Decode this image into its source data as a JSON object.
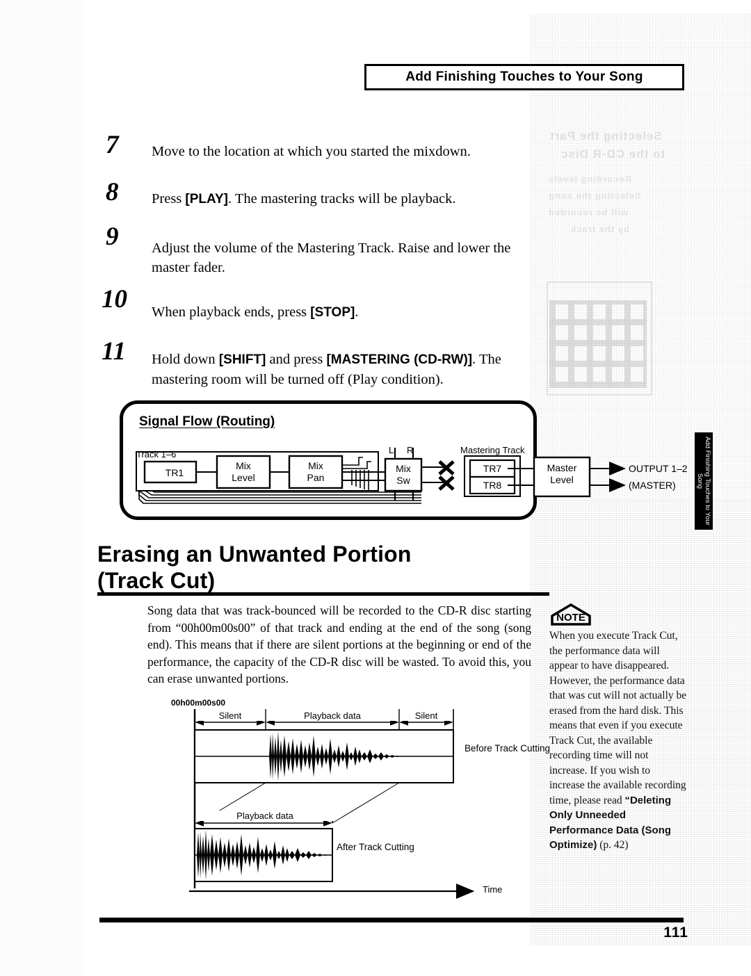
{
  "header": {
    "banner_title": "Add Finishing Touches to Your Song"
  },
  "side_tab": {
    "label": "Add Finishing Touches to Your Song"
  },
  "steps": [
    {
      "number": "7",
      "segments": [
        {
          "t": "Move to the location at which you started the mixdown.",
          "b": false
        }
      ]
    },
    {
      "number": "8",
      "segments": [
        {
          "t": "Press ",
          "b": false
        },
        {
          "t": "[PLAY]",
          "b": true
        },
        {
          "t": ". The mastering tracks will be playback.",
          "b": false
        }
      ]
    },
    {
      "number": "9",
      "segments": [
        {
          "t": "Adjust the volume of the Mastering Track. Raise and lower the master fader.",
          "b": false
        }
      ]
    },
    {
      "number": "10",
      "segments": [
        {
          "t": "When playback ends, press ",
          "b": false
        },
        {
          "t": "[STOP]",
          "b": true
        },
        {
          "t": ".",
          "b": false
        }
      ]
    },
    {
      "number": "11",
      "segments": [
        {
          "t": "Hold down ",
          "b": false
        },
        {
          "t": "[SHIFT]",
          "b": true
        },
        {
          "t": " and press ",
          "b": false
        },
        {
          "t": "[MASTERING (CD-RW)]",
          "b": true
        },
        {
          "t": ". The mastering room will be turned off (Play condition).",
          "b": false
        }
      ]
    }
  ],
  "signal_flow": {
    "title": "Signal Flow (Routing)",
    "labels": {
      "track_group": "Track 1–6",
      "tr1": "TR1",
      "mix_level": [
        "Mix",
        "Level"
      ],
      "mix_pan": [
        "Mix",
        "Pan"
      ],
      "l": "L",
      "r": "R",
      "mix_sw": [
        "Mix",
        "Sw"
      ],
      "mastering_track": "Mastering Track",
      "tr7": "TR7",
      "tr8": "TR8",
      "master_level": [
        "Master",
        "Level"
      ],
      "output_line1": "OUTPUT 1–2",
      "output_line2": "(MASTER)"
    }
  },
  "section": {
    "heading_line1": "Erasing an Unwanted Portion",
    "heading_line2": "(Track Cut)",
    "body": "Song data that was track-bounced will be recorded to the CD-R disc starting from “00h00m00s00” of that track and ending at the end of the song (song end). This means that if there are silent portions at the beginning or end of the performance, the capacity of the CD-R disc will be wasted. To avoid this, you can erase unwanted portions."
  },
  "figure": {
    "timecode": "00h00m00s00",
    "silent_left": "Silent",
    "playback_data": "Playback data",
    "silent_right": "Silent",
    "before_label": "Before Track Cutting",
    "playback_data_after": "Playback data",
    "after_label": "After Track Cutting",
    "time_axis": "Time"
  },
  "note": {
    "icon_label": "NOTE",
    "segments": [
      {
        "t": "When you execute Track Cut, the performance data will appear to have disappeared. However, the performance data that was cut will not actually be erased from the hard disk. This means that even if you execute Track Cut, the available recording time will not increase. If you wish to increase the available recording time, please read ",
        "b": false
      },
      {
        "t": "“Deleting Only Unneeded Performance Data (Song Optimize)",
        "b": true
      },
      {
        "t": " (p. 42)",
        "b": false
      }
    ]
  },
  "footer": {
    "page_number": "111"
  }
}
